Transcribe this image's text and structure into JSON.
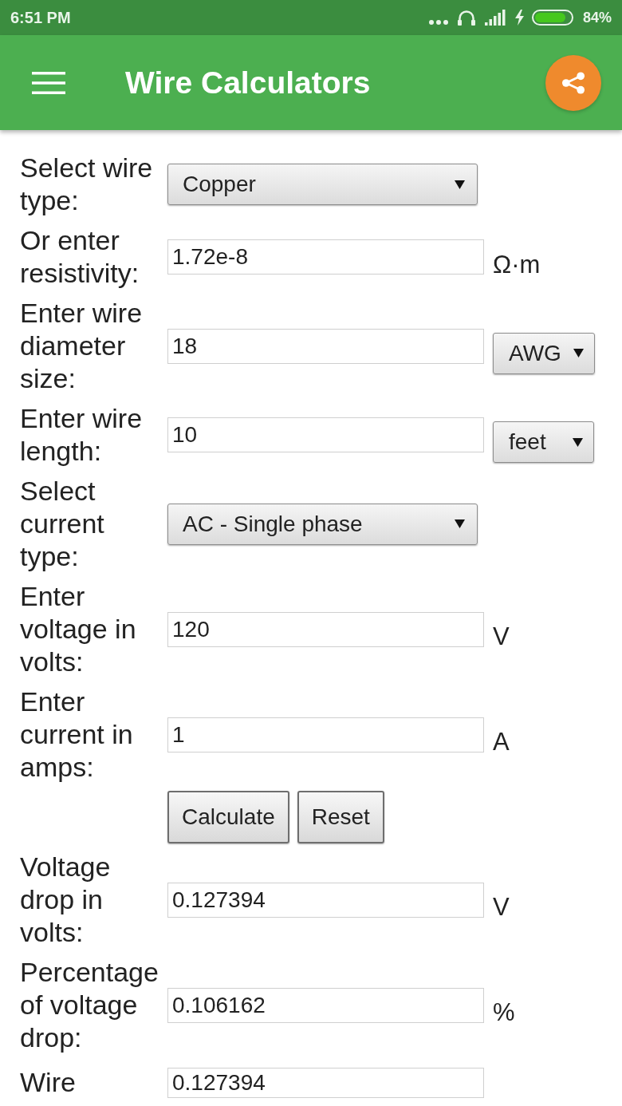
{
  "status_bar": {
    "time": "6:51 PM",
    "battery": "84%"
  },
  "app_bar": {
    "title": "Wire Calculators"
  },
  "form": {
    "rows": [
      {
        "kind": "select",
        "label": "Select wire type:",
        "value": "Copper"
      },
      {
        "kind": "input",
        "label": "Or enter resistivity:",
        "value": "1.72e-8",
        "unit": {
          "kind": "text",
          "text": "Ω·m"
        }
      },
      {
        "kind": "input",
        "label": "Enter wire diameter size:",
        "value": "18",
        "unit": {
          "kind": "select",
          "text": "AWG"
        }
      },
      {
        "kind": "input",
        "label": "Enter wire length:",
        "value": "10",
        "unit": {
          "kind": "select",
          "text": "feet"
        }
      },
      {
        "kind": "select",
        "label": "Select current type:",
        "value": "AC - Single phase"
      },
      {
        "kind": "input",
        "label": "Enter voltage in volts:",
        "value": "120",
        "unit": {
          "kind": "text",
          "text": "V"
        }
      },
      {
        "kind": "input",
        "label": "Enter current in amps:",
        "value": "1",
        "unit": {
          "kind": "text",
          "text": "A"
        }
      },
      {
        "kind": "buttons",
        "buttons": [
          "Calculate",
          "Reset"
        ]
      },
      {
        "kind": "input",
        "label": "Voltage drop in volts:",
        "value": "0.127394",
        "unit": {
          "kind": "text",
          "text": "V"
        }
      },
      {
        "kind": "input",
        "label": "Percentage of voltage drop:",
        "value": "0.106162",
        "unit": {
          "kind": "text",
          "text": "%"
        }
      },
      {
        "kind": "input",
        "label": "Wire",
        "value": "0.127394"
      }
    ]
  }
}
